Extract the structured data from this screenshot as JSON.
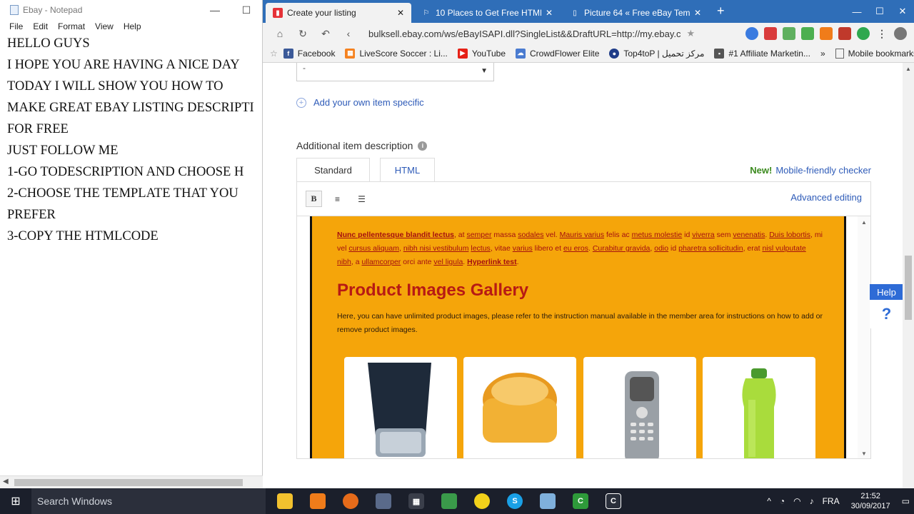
{
  "notepad": {
    "title": "Ebay - Notepad",
    "minimize": "—",
    "maximize": "☐",
    "menu": [
      "File",
      "Edit",
      "Format",
      "View",
      "Help"
    ],
    "text_lines": [
      "HELLO GUYS",
      "I HOPE YOU ARE HAVING A NICE DAY",
      "TODAY I WILL SHOW YOU HOW TO",
      "MAKE GREAT EBAY LISTING DESCRIPTI",
      "FOR FREE",
      "JUST FOLLOW ME",
      "1-GO TODESCRIPTION AND CHOOSE H",
      "2-CHOOSE THE TEMPLATE THAT YOU",
      "PREFER",
      "3-COPY THE HTMLCODE"
    ],
    "scroll_left": "◀"
  },
  "browser": {
    "tabs": [
      {
        "title": "Create your listing",
        "active": true
      },
      {
        "title": "10 Places to Get Free HTML el",
        "active": false
      },
      {
        "title": "Picture 64 « Free eBay Templa",
        "active": false
      }
    ],
    "tab_close": "✕",
    "new_tab": "+",
    "win_ctrls": [
      "—",
      "☐",
      "✕"
    ],
    "nav": {
      "home": "⌂",
      "reload": "↻",
      "undo": "↶",
      "back": "‹"
    },
    "url": "bulksell.ebay.com/ws/eBayISAPI.dll?SingleList&&DraftURL=http://my.ebay.c",
    "url_star": "★",
    "menu_dots": "⋮",
    "bookmarks": [
      {
        "label": "Facebook",
        "color": "#3b5998",
        "icon": "f"
      },
      {
        "label": "LiveScore Soccer : Li...",
        "color": "#f58220",
        "icon": "▦"
      },
      {
        "label": "YouTube",
        "color": "#e62117",
        "icon": "▶"
      },
      {
        "label": "CrowdFlower Elite",
        "color": "#4a7bd0",
        "icon": "☁"
      },
      {
        "label": "Top4toP | مركز تحميل",
        "color": "#1f3c88",
        "icon": "●"
      },
      {
        "label": "#1 Affiliate Marketin...",
        "color": "#555555",
        "icon": "▪"
      }
    ],
    "bookmarks_more": "»",
    "mobile_bookmarks": "Mobile bookmarks"
  },
  "listing": {
    "select_value": "-",
    "add_specific": "Add your own item specific",
    "desc_label": "Additional item description",
    "tab_standard": "Standard",
    "tab_html": "HTML",
    "mobile_new": "New!",
    "mobile_checker": "Mobile-friendly checker",
    "advanced_editing": "Advanced editing",
    "bold_btn": "B",
    "ol_btn": "≡",
    "ul_btn": "☰"
  },
  "template": {
    "para_parts": [
      {
        "text": "Nunc pellentesque blandit lectus",
        "bold": true,
        "u": true
      },
      {
        "text": ", at ",
        "bold": false,
        "u": false
      },
      {
        "text": "semper",
        "bold": false,
        "u": true
      },
      {
        "text": "  massa ",
        "bold": false,
        "u": false
      },
      {
        "text": "sodales",
        "bold": false,
        "u": true
      },
      {
        "text": " vel. ",
        "bold": false,
        "u": false
      },
      {
        "text": "Mauris varius",
        "bold": false,
        "u": true
      },
      {
        "text": " felis ac ",
        "bold": false,
        "u": false
      },
      {
        "text": "metus molestie",
        "bold": false,
        "u": true
      },
      {
        "text": " id ",
        "bold": false,
        "u": false
      },
      {
        "text": "viverra",
        "bold": false,
        "u": true
      },
      {
        "text": "  sem ",
        "bold": false,
        "u": false
      },
      {
        "text": "venenatis",
        "bold": false,
        "u": true
      },
      {
        "text": ". ",
        "bold": false,
        "u": false
      },
      {
        "text": "Duis lobortis",
        "bold": false,
        "u": true
      },
      {
        "text": ", mi vel ",
        "bold": false,
        "u": false
      },
      {
        "text": "cursus aliquam",
        "bold": false,
        "u": true
      },
      {
        "text": ", ",
        "bold": false,
        "u": false
      },
      {
        "text": "nibh nisi vestibulum",
        "bold": false,
        "u": true
      },
      {
        "text": "  ",
        "bold": false,
        "u": false
      },
      {
        "text": "lectus",
        "bold": false,
        "u": true
      },
      {
        "text": ", vitae ",
        "bold": false,
        "u": false
      },
      {
        "text": "varius",
        "bold": false,
        "u": true
      },
      {
        "text": " libero et ",
        "bold": false,
        "u": false
      },
      {
        "text": "eu eros",
        "bold": false,
        "u": true
      },
      {
        "text": ". ",
        "bold": false,
        "u": false
      },
      {
        "text": "Curabitur gravida",
        "bold": false,
        "u": true
      },
      {
        "text": ", ",
        "bold": false,
        "u": false
      },
      {
        "text": "odio",
        "bold": false,
        "u": true
      },
      {
        "text": "  id ",
        "bold": false,
        "u": false
      },
      {
        "text": "pharetra sollicitudin",
        "bold": false,
        "u": true
      },
      {
        "text": ", erat ",
        "bold": false,
        "u": false
      },
      {
        "text": "nisl vulputate nibh",
        "bold": false,
        "u": true
      },
      {
        "text": ", a ",
        "bold": false,
        "u": false
      },
      {
        "text": "ullamcorper",
        "bold": false,
        "u": true
      },
      {
        "text": "  orci ante ",
        "bold": false,
        "u": false
      },
      {
        "text": "vel ligula",
        "bold": false,
        "u": true
      },
      {
        "text": ". ",
        "bold": false,
        "u": false
      },
      {
        "text": "Hyperlink test",
        "bold": true,
        "u": true
      },
      {
        "text": ".",
        "bold": false,
        "u": false
      }
    ],
    "gallery_title": "Product Images Gallery",
    "gallery_text": "Here, you can have unlimited product images, please refer to  the instruction manual available in the member area for instructions on how to add or remove product images."
  },
  "help": {
    "label": "Help",
    "question": "?"
  },
  "taskbar": {
    "search": "Search Windows",
    "lang": "FRA",
    "time": "21:52",
    "date": "30/09/2017"
  }
}
